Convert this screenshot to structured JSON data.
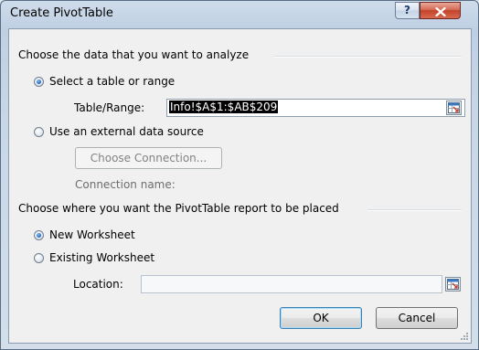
{
  "window": {
    "title": "Create PivotTable",
    "help_label": "?"
  },
  "source_group": {
    "title": "Choose the data that you want to analyze",
    "select_range_option": {
      "label": "Select a table or range",
      "checked": true
    },
    "table_range_label": "Table/Range:",
    "table_range_value": "Info!$A$1:$AB$209",
    "external_option": {
      "label": "Use an external data source",
      "checked": false
    },
    "choose_connection_label": "Choose Connection...",
    "connection_name_label": "Connection name:"
  },
  "placement_group": {
    "title": "Choose where you want the PivotTable report to be placed",
    "new_worksheet_option": {
      "label": "New Worksheet",
      "checked": true
    },
    "existing_worksheet_option": {
      "label": "Existing Worksheet",
      "checked": false
    },
    "location_label": "Location:",
    "location_value": ""
  },
  "buttons": {
    "ok_label": "OK",
    "cancel_label": "Cancel"
  },
  "icons": {
    "range_picker": "range-picker-icon",
    "close": "close-icon"
  },
  "colors": {
    "title_bar": "#c7d6e6",
    "close_button": "#c3432b",
    "selection": "#000000"
  }
}
